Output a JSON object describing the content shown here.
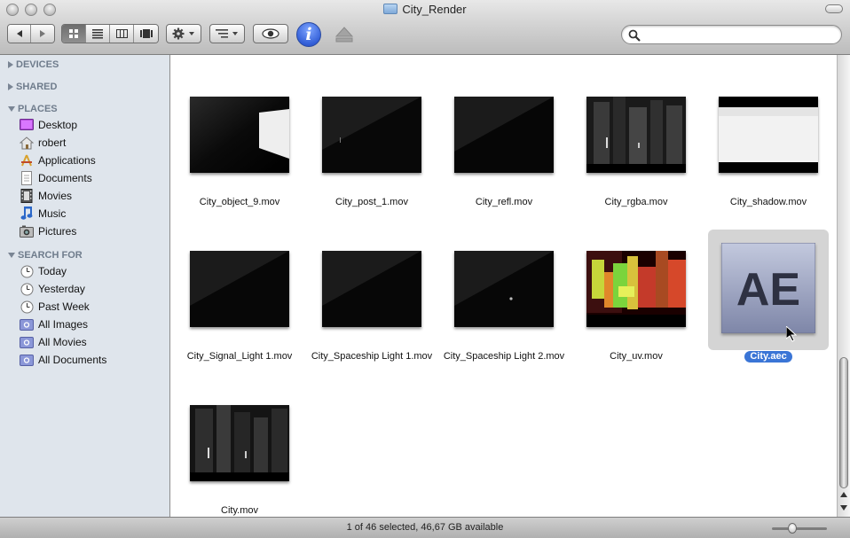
{
  "window": {
    "title": "City_Render"
  },
  "toolbar": {
    "back_icon": "back-arrow-icon",
    "forward_icon": "forward-arrow-icon",
    "view_modes": [
      "icon-view",
      "list-view",
      "column-view",
      "cover-flow-view"
    ],
    "active_view": "icon-view",
    "action_icon": "gear-icon",
    "arrange_icon": "arrange-icon",
    "quicklook_icon": "eye-icon",
    "info_label": "i",
    "eject_icon": "eject-icon",
    "search_placeholder": ""
  },
  "sidebar": {
    "devices": "DEVICES",
    "shared": "SHARED",
    "places": "PLACES",
    "places_items": [
      {
        "label": "Desktop",
        "icon": "desktop-icon"
      },
      {
        "label": "robert",
        "icon": "home-icon"
      },
      {
        "label": "Applications",
        "icon": "applications-icon"
      },
      {
        "label": "Documents",
        "icon": "documents-icon"
      },
      {
        "label": "Movies",
        "icon": "movies-icon"
      },
      {
        "label": "Music",
        "icon": "music-icon"
      },
      {
        "label": "Pictures",
        "icon": "pictures-icon"
      }
    ],
    "search_for": "SEARCH FOR",
    "search_items": [
      {
        "label": "Today",
        "icon": "clock-icon"
      },
      {
        "label": "Yesterday",
        "icon": "clock-icon"
      },
      {
        "label": "Past Week",
        "icon": "clock-icon"
      },
      {
        "label": "All Images",
        "icon": "smart-folder-icon"
      },
      {
        "label": "All Movies",
        "icon": "smart-folder-icon"
      },
      {
        "label": "All Documents",
        "icon": "smart-folder-icon"
      }
    ]
  },
  "files": [
    {
      "name": "City_object_9.mov",
      "thumb": "object"
    },
    {
      "name": "City_post_1.mov",
      "thumb": "dark"
    },
    {
      "name": "City_refl.mov",
      "thumb": "dark"
    },
    {
      "name": "City_rgba.mov",
      "thumb": "city"
    },
    {
      "name": "City_shadow.mov",
      "thumb": "shadow"
    },
    {
      "name": "City_Signal_Light 1.mov",
      "thumb": "dark"
    },
    {
      "name": "City_Spaceship Light 1.mov",
      "thumb": "dark"
    },
    {
      "name": "City_Spaceship Light 2.mov",
      "thumb": "dark"
    },
    {
      "name": "City_uv.mov",
      "thumb": "uv"
    },
    {
      "name": "City.aec",
      "thumb": "ae",
      "selected": true
    },
    {
      "name": "City.mov",
      "thumb": "city"
    }
  ],
  "ae_icon_text": "AE",
  "status": {
    "text": "1 of 46 selected, 46,67 GB available"
  },
  "colors": {
    "selection": "#3a75d6",
    "sidebar_bg": "#dfe5ec",
    "sidebar_header": "#6f7c8c"
  }
}
